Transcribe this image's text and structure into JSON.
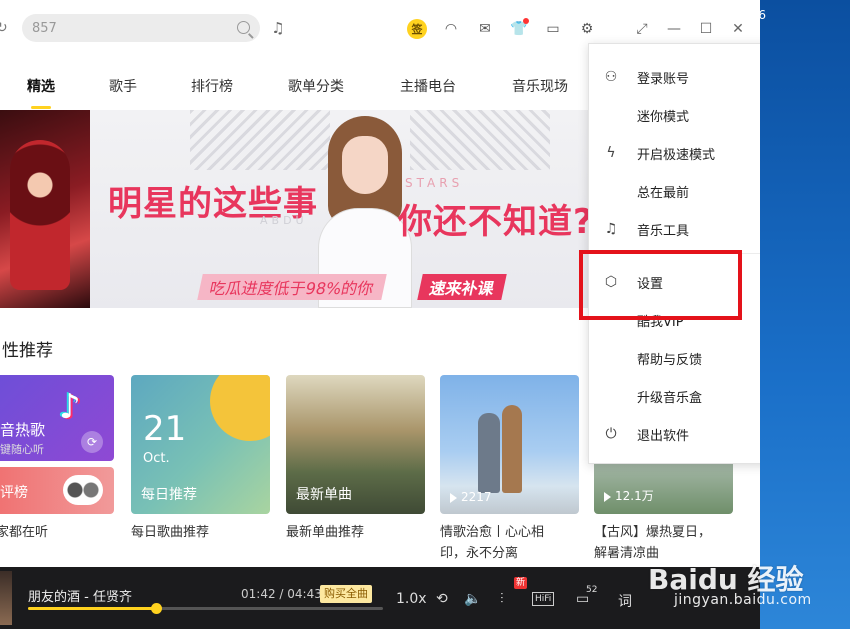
{
  "search": {
    "value": "857"
  },
  "topbar": {
    "signin_label": "签"
  },
  "nav": {
    "tabs": [
      "精选",
      "歌手",
      "排行榜",
      "歌单分类",
      "主播电台",
      "音乐现场"
    ]
  },
  "banner": {
    "headline_left": "明星的这些事",
    "headline_right": "你还不知道?",
    "stars": "STARS",
    "abdu": "ABDU",
    "pill_left": "吃瓜进度低于98%的你",
    "pill_right": "速来补课"
  },
  "section": {
    "title": "性推荐"
  },
  "cards": {
    "c1_title": "音热歌",
    "c1_sub": "键随心听",
    "c1_bottom": "评榜",
    "c2_day": "21",
    "c2_mon": "Oct.",
    "c2_overlay": "每日推荐",
    "c3_overlay": "最新单曲",
    "c4_plays": "2217",
    "c5_plays": "12.1万"
  },
  "captions": {
    "c1": "家都在听",
    "c2": "每日歌曲推荐",
    "c3": "最新单曲推荐",
    "c4": "情歌治愈丨心心相印，永不分离",
    "c5": "【古风】爆热夏日，解暑清凉曲"
  },
  "menu": {
    "items": [
      "登录账号",
      "迷你模式",
      "开启极速模式",
      "总在最前",
      "音乐工具",
      "设置",
      "酷我VIP",
      "帮助与反馈",
      "升级音乐盒",
      "退出软件"
    ]
  },
  "player": {
    "song": "朋友的酒 - 任贤齐",
    "time": "01:42 / 04:43",
    "buy": "购买全曲",
    "speed": "1.0x",
    "new_badge": "新",
    "hifi": "HiFi",
    "comments": "52",
    "progress": 0.36
  },
  "desktop": {
    "edge_number": "6"
  },
  "watermark": {
    "logo": "Baidu 经验",
    "url": "jingyan.baidu.com"
  },
  "colors": {
    "accent": "#ffd21f",
    "highlight": "#e4121a",
    "banner_text": "#e8365d"
  }
}
